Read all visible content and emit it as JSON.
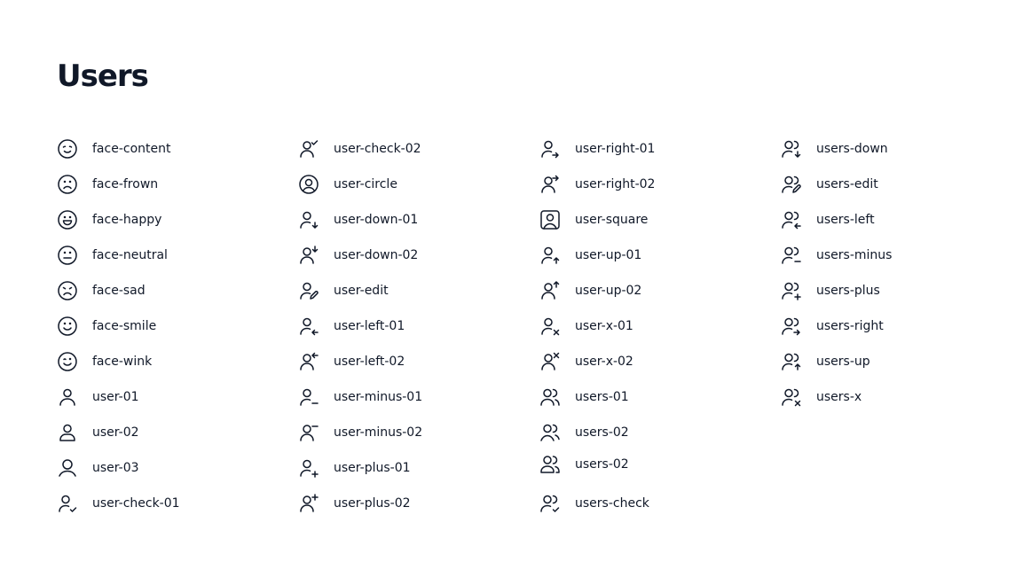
{
  "page": {
    "title": "Users"
  },
  "colors": {
    "text": "#101828",
    "background": "#ffffff"
  },
  "columns": [
    {
      "items": [
        {
          "label": "face-content",
          "icon": "face-content-icon"
        },
        {
          "label": "face-frown",
          "icon": "face-frown-icon"
        },
        {
          "label": "face-happy",
          "icon": "face-happy-icon"
        },
        {
          "label": "face-neutral",
          "icon": "face-neutral-icon"
        },
        {
          "label": "face-sad",
          "icon": "face-sad-icon"
        },
        {
          "label": "face-smile",
          "icon": "face-smile-icon"
        },
        {
          "label": "face-wink",
          "icon": "face-wink-icon"
        },
        {
          "label": "user-01",
          "icon": "user-01-icon"
        },
        {
          "label": "user-02",
          "icon": "user-02-icon"
        },
        {
          "label": "user-03",
          "icon": "user-03-icon"
        },
        {
          "label": "user-check-01",
          "icon": "user-check-01-icon"
        }
      ]
    },
    {
      "items": [
        {
          "label": "user-check-02",
          "icon": "user-check-02-icon"
        },
        {
          "label": "user-circle",
          "icon": "user-circle-icon"
        },
        {
          "label": "user-down-01",
          "icon": "user-down-01-icon"
        },
        {
          "label": "user-down-02",
          "icon": "user-down-02-icon"
        },
        {
          "label": "user-edit",
          "icon": "user-edit-icon"
        },
        {
          "label": "user-left-01",
          "icon": "user-left-01-icon"
        },
        {
          "label": "user-left-02",
          "icon": "user-left-02-icon"
        },
        {
          "label": "user-minus-01",
          "icon": "user-minus-01-icon"
        },
        {
          "label": "user-minus-02",
          "icon": "user-minus-02-icon"
        },
        {
          "label": "user-plus-01",
          "icon": "user-plus-01-icon"
        },
        {
          "label": "user-plus-02",
          "icon": "user-plus-02-icon"
        }
      ]
    },
    {
      "items": [
        {
          "label": "user-right-01",
          "icon": "user-right-01-icon"
        },
        {
          "label": "user-right-02",
          "icon": "user-right-02-icon"
        },
        {
          "label": "user-square",
          "icon": "user-square-icon"
        },
        {
          "label": "user-up-01",
          "icon": "user-up-01-icon"
        },
        {
          "label": "user-up-02",
          "icon": "user-up-02-icon"
        },
        {
          "label": "user-x-01",
          "icon": "user-x-01-icon"
        },
        {
          "label": "user-x-02",
          "icon": "user-x-02-icon"
        },
        {
          "label": "users-01",
          "icon": "users-01-icon"
        },
        {
          "label": "users-02",
          "icon": "users-02-icon"
        },
        {
          "label": "users-02",
          "icon": "users-02-alt-icon"
        },
        {
          "label": "users-check",
          "icon": "users-check-icon"
        }
      ]
    },
    {
      "items": [
        {
          "label": "users-down",
          "icon": "users-down-icon"
        },
        {
          "label": "users-edit",
          "icon": "users-edit-icon"
        },
        {
          "label": "users-left",
          "icon": "users-left-icon"
        },
        {
          "label": "users-minus",
          "icon": "users-minus-icon"
        },
        {
          "label": "users-plus",
          "icon": "users-plus-icon"
        },
        {
          "label": "users-right",
          "icon": "users-right-icon"
        },
        {
          "label": "users-up",
          "icon": "users-up-icon"
        },
        {
          "label": "users-x",
          "icon": "users-x-icon"
        }
      ]
    }
  ]
}
